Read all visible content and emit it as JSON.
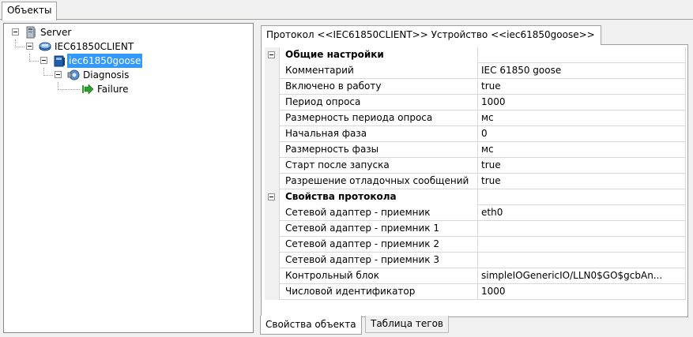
{
  "top_tab": {
    "label": "Объекты"
  },
  "tree": {
    "server": "Server",
    "client": "IEC61850CLIENT",
    "goose": "iec61850goose",
    "diagnosis": "Diagnosis",
    "failure": "Failure"
  },
  "inner_tab": {
    "label": "Протокол <<IEC61850CLIENT>> Устройство <<iec61850goose>>"
  },
  "properties": {
    "general_header": "Общие настройки",
    "general": [
      {
        "name": "Комментарий",
        "value": "IEC 61850 goose"
      },
      {
        "name": "Включено в работу",
        "value": "true"
      },
      {
        "name": "Период опроса",
        "value": "1000"
      },
      {
        "name": "Размерность периода опроса",
        "value": "мс"
      },
      {
        "name": "Начальная фаза",
        "value": "0"
      },
      {
        "name": "Размерность фазы",
        "value": "мс"
      },
      {
        "name": "Старт после запуска",
        "value": "true"
      },
      {
        "name": "Разрешение отладочных сообщений",
        "value": "true"
      }
    ],
    "protocol_header": "Свойства протокола",
    "protocol": [
      {
        "name": "Сетевой адаптер - приемник",
        "value": "eth0"
      },
      {
        "name": "Сетевой адаптер - приемник 1",
        "value": ""
      },
      {
        "name": "Сетевой адаптер - приемник 2",
        "value": ""
      },
      {
        "name": "Сетевой адаптер - приемник 3",
        "value": ""
      },
      {
        "name": "Контрольный блок",
        "value": "simpleIOGenericIO/LLN0$GO$gcbAn..."
      },
      {
        "name": "Числовой идентификатор",
        "value": "1000"
      }
    ]
  },
  "bottom_tabs": {
    "properties": "Свойства объекта",
    "tags": "Таблица тегов"
  },
  "icons": {
    "server": "server-icon",
    "client": "network-icon",
    "goose": "device-icon",
    "diagnosis": "diagnosis-icon",
    "failure": "arrow-icon"
  },
  "colors": {
    "selection": "#3399ff",
    "failure_arrow": "#2e9e2e",
    "device_blue": "#1f5fa8"
  }
}
